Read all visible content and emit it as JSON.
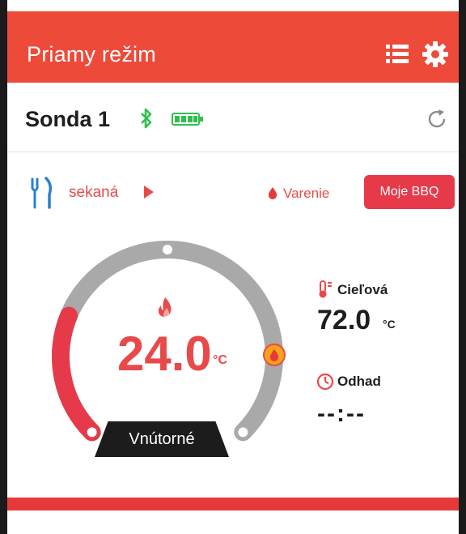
{
  "header": {
    "title": "Priamy režim",
    "icons": [
      "list-icon",
      "gear-icon"
    ],
    "color": "#ee4a3a"
  },
  "probe": {
    "name": "Sonda 1",
    "icons": [
      "bluetooth-icon",
      "battery-icon",
      "refresh-icon"
    ],
    "bluetooth_color": "#2fbf4f",
    "battery_color": "#2fbf4f"
  },
  "food": {
    "name": "sekaná",
    "mode": "Varenie",
    "bbq_button": "Moje BBQ",
    "accent_color": "#e84a4a"
  },
  "gauge": {
    "current_value": "24.0",
    "current_unit": "°C",
    "label": "Vnútorné",
    "progress_fraction": 0.25,
    "target_fraction": 0.83
  },
  "target": {
    "label": "Cieľová",
    "value": "72.0",
    "unit": "°C"
  },
  "estimate": {
    "label": "Odhad",
    "value": "--:--"
  }
}
